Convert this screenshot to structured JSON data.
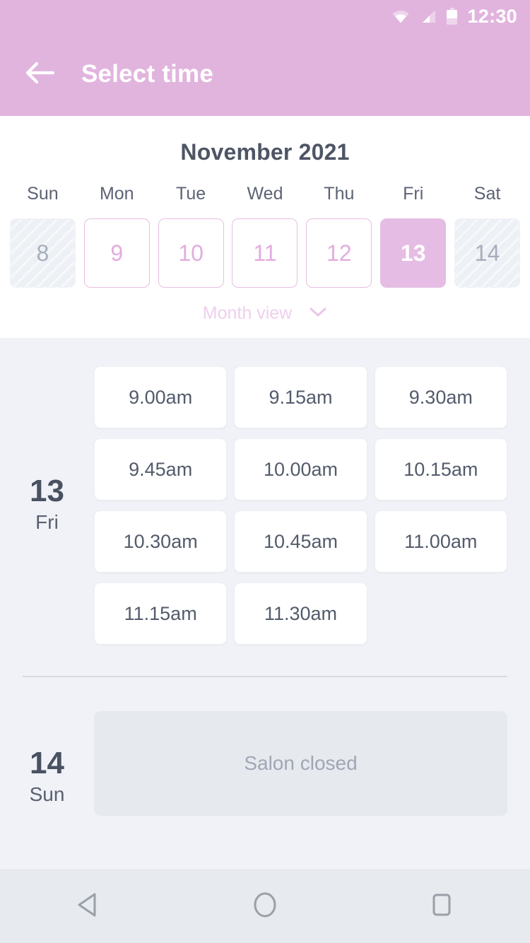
{
  "status_bar": {
    "time": "12:30",
    "icons": [
      "wifi-icon",
      "signal-icon",
      "battery-icon"
    ]
  },
  "app_bar": {
    "back_icon": "arrow-left-icon",
    "title": "Select time"
  },
  "calendar": {
    "month_title": "November 2021",
    "weekdays": [
      "Sun",
      "Mon",
      "Tue",
      "Wed",
      "Thu",
      "Fri",
      "Sat"
    ],
    "days": [
      {
        "num": "8",
        "state": "disabled"
      },
      {
        "num": "9",
        "state": "available"
      },
      {
        "num": "10",
        "state": "available"
      },
      {
        "num": "11",
        "state": "available"
      },
      {
        "num": "12",
        "state": "available"
      },
      {
        "num": "13",
        "state": "selected"
      },
      {
        "num": "14",
        "state": "disabled"
      }
    ],
    "month_view_label": "Month view",
    "month_view_icon": "chevron-down-icon"
  },
  "schedule": {
    "day_13": {
      "day_num": "13",
      "day_name": "Fri",
      "slots": [
        "9.00am",
        "9.15am",
        "9.30am",
        "9.45am",
        "10.00am",
        "10.15am",
        "10.30am",
        "10.45am",
        "11.00am",
        "11.15am",
        "11.30am"
      ]
    },
    "day_14": {
      "day_num": "14",
      "day_name": "Sun",
      "closed_label": "Salon closed"
    }
  },
  "nav_bar": {
    "back_label": "back-triangle-icon",
    "home_label": "home-circle-icon",
    "recents_label": "recents-square-icon"
  },
  "colors": {
    "brand_pink": "#E1B4DE",
    "selected_pink": "#E5BCE3",
    "border_pink": "#E7BEE4",
    "slot_bg": "#F0F2F7",
    "text_dark": "#4A5262",
    "closed_card": "#E6E9EE"
  }
}
